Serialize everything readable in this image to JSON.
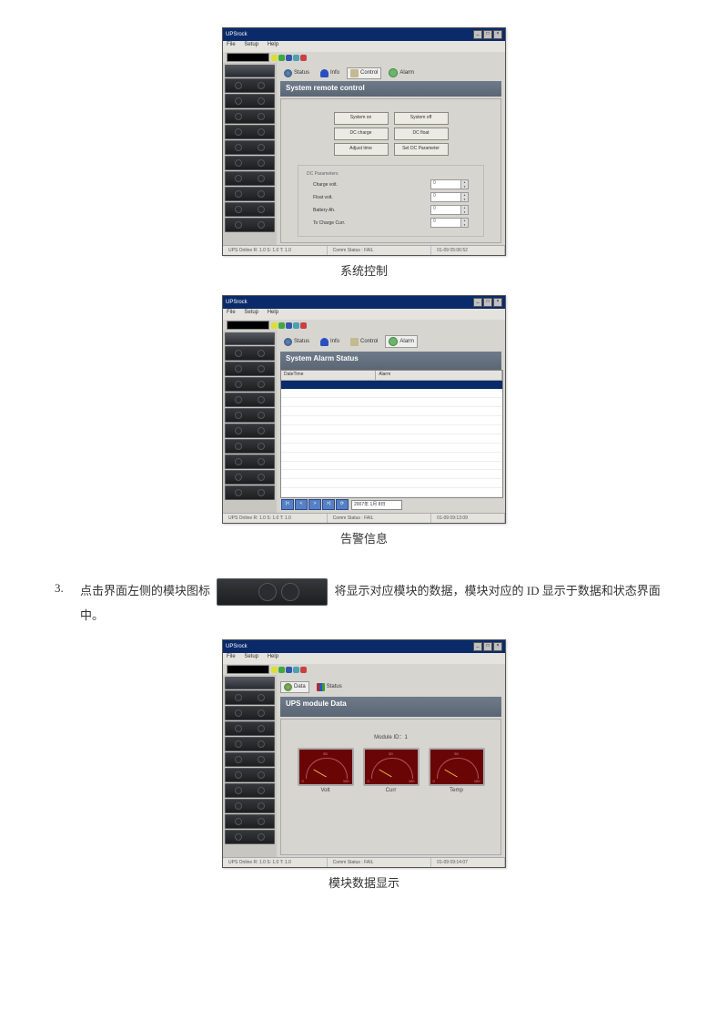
{
  "captions": {
    "c1": "系统控制",
    "c2": "告警信息",
    "c3": "模块数据显示"
  },
  "bodyText": {
    "number": "3.",
    "part1": "点击界面左侧的模块图标",
    "part2": "将显示对应模块的数据，模块对应的 ID 显示于数据和状态界面中。"
  },
  "appTitle": "UPSrock",
  "menu": {
    "m1": "File",
    "m2": "Setup",
    "m3": "Help"
  },
  "tabs": {
    "status": "Status",
    "info": "Info",
    "control": "Control",
    "alarm": "Alarm",
    "data": "Data"
  },
  "screen1": {
    "header": "System remote control",
    "btns": {
      "b1": "System on",
      "b2": "System off",
      "b3": "DC charge",
      "b4": "DC float",
      "b5": "Adjust time",
      "b6": "Set DC Parameter"
    },
    "groupTitle": "DC Parameters",
    "params": {
      "p1": "Charge volt.",
      "p2": "Float volt.",
      "p3": "Battery Ah.",
      "p4": "To Charge Curr."
    },
    "value": "0"
  },
  "screen2": {
    "header": "System Alarm Status",
    "col1": "DateTime",
    "col2": "Alarm",
    "dateValue": "2007年 1月 8日"
  },
  "screen3": {
    "header": "UPS module Data",
    "moduleId": "Module ID：1",
    "gauges": {
      "g1": "Volt",
      "g2": "Curr",
      "g3": "Temp",
      "min": "0",
      "mid": "50",
      "max": "100"
    }
  },
  "statusBar": {
    "s1": "UPS Online   R: 1.0   S: 1.0   T: 1.0",
    "s2": "Comm Status : FAIL",
    "s3a": "01-09 05:06:52",
    "s3b": "01-09 09:13:09",
    "s3c": "01-09 09:14:07"
  }
}
